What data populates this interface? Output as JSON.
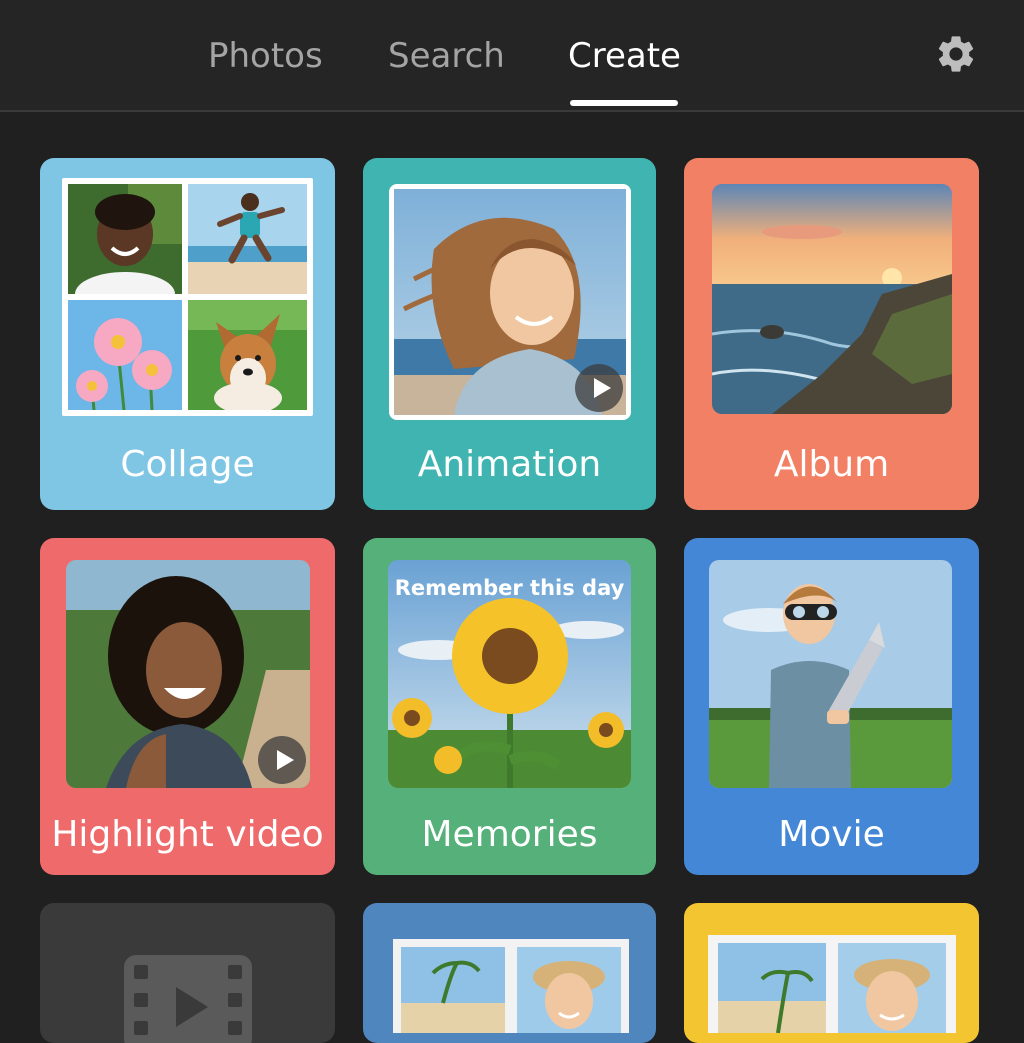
{
  "tabs": [
    {
      "label": "Photos",
      "active": false
    },
    {
      "label": "Search",
      "active": false
    },
    {
      "label": "Create",
      "active": true
    }
  ],
  "header": {
    "settings_icon": "gear-icon"
  },
  "cards": {
    "collage": {
      "label": "Collage",
      "color": "#7ec6e4"
    },
    "animation": {
      "label": "Animation",
      "color": "#3fb4b0"
    },
    "album": {
      "label": "Album",
      "color": "#f28064"
    },
    "highlight": {
      "label": "Highlight video",
      "color": "#ef6b6b"
    },
    "memories": {
      "label": "Memories",
      "color": "#55b07a",
      "overlay_text": "Remember this day"
    },
    "movie": {
      "label": "Movie",
      "color": "#4487d6"
    },
    "film": {
      "icon": "film-play-icon",
      "color": "#3a3a3a"
    },
    "photobook1": {
      "color": "#4e86bd"
    },
    "photobook2": {
      "color": "#f2c531"
    }
  },
  "icons": {
    "play": "play-icon"
  }
}
